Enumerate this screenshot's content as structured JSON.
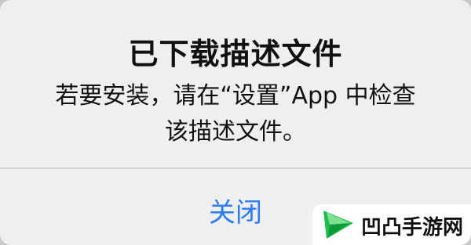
{
  "alert": {
    "title": "已下载描述文件",
    "message": "若要安装，请在“设置”App 中检查该描述文件。",
    "close_label": "关闭"
  },
  "watermark": {
    "text": "凹凸手游网",
    "logo_icon": "play-triangle-logo"
  },
  "colors": {
    "alert_background": "#efefef",
    "button_text": "#2b7cf6",
    "title_text": "#111111",
    "divider": "#d4d4d4"
  }
}
